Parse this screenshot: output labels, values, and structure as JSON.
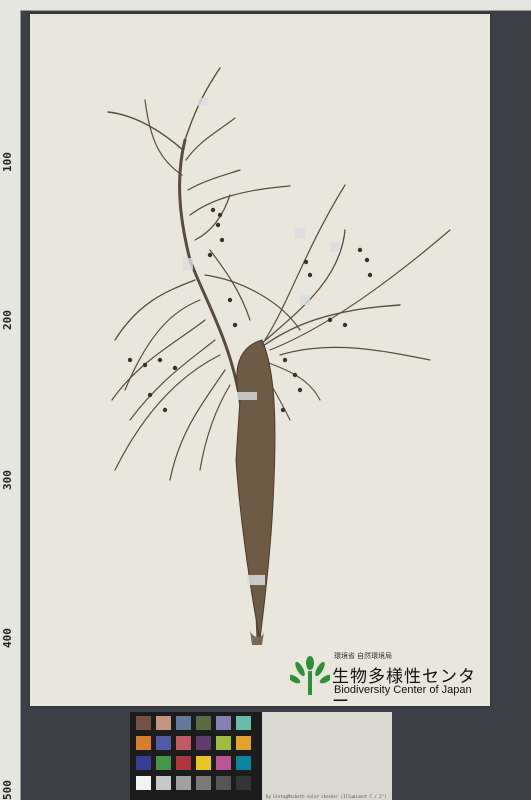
{
  "ruler": {
    "labels": [
      "100",
      "200",
      "300",
      "400",
      "500"
    ]
  },
  "logo": {
    "ministry": "環境省 自然環境局",
    "name_jp": "生物多様性センター",
    "name_en": "Biodiversity Center of Japan"
  },
  "color_card": {
    "caption": "by GretagMacbeth color checker (Illuminant C / 2°)",
    "swatch_colors": [
      "#735244",
      "#c29682",
      "#627a9d",
      "#576c43",
      "#8580b1",
      "#67bdaa",
      "#d67e2c",
      "#505ba6",
      "#c15a63",
      "#5e3c6c",
      "#9dbc40",
      "#e0a32e",
      "#383d96",
      "#469449",
      "#af363c",
      "#e7c71f",
      "#bb5695",
      "#0885a1",
      "#f3f3f2",
      "#c8c8c8",
      "#a0a0a0",
      "#7a7a79",
      "#555555",
      "#343434"
    ]
  },
  "colors": {
    "sheet": "#e9e7dc",
    "stem": "#5e5140",
    "logo_green": "#2f8f3a"
  }
}
